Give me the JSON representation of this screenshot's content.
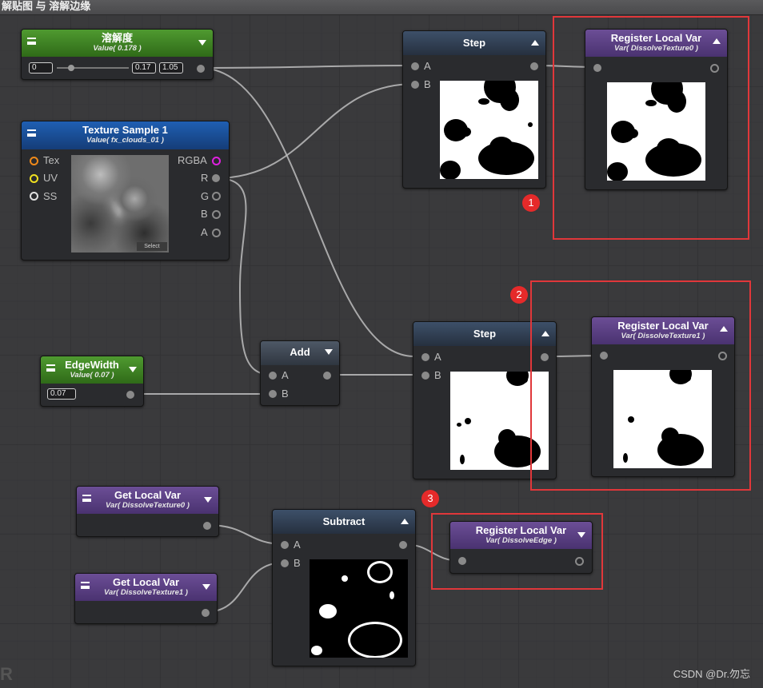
{
  "window": {
    "title": "解贴图 与 溶解边缘"
  },
  "nodes": {
    "dissolve": {
      "title": "溶解度",
      "subtitle": "Value( 0.178 )",
      "min": "0",
      "value": "0.17",
      "max": "1.05",
      "color": "#3f8a24"
    },
    "texture": {
      "title": "Texture Sample 1",
      "subtitle": "Value( fx_clouds_01 )",
      "inputs": [
        "Tex",
        "UV",
        "SS"
      ],
      "outputs": [
        "RGBA",
        "R",
        "G",
        "B",
        "A"
      ],
      "select": "Select",
      "color": "#1f5fb3"
    },
    "edge": {
      "title": "EdgeWidth",
      "subtitle": "Value( 0.07 )",
      "value": "0.07",
      "color": "#3f8a24"
    },
    "add": {
      "title": "Add",
      "inputs": [
        "A",
        "B"
      ]
    },
    "step1": {
      "title": "Step",
      "inputs": [
        "A",
        "B"
      ]
    },
    "step2": {
      "title": "Step",
      "inputs": [
        "A",
        "B"
      ]
    },
    "reg1": {
      "title": "Register Local Var",
      "subtitle": "Var( DissolveTexture0 )",
      "color": "#6c4e96"
    },
    "reg2": {
      "title": "Register Local Var",
      "subtitle": "Var( DissolveTexture1 )",
      "color": "#6c4e96"
    },
    "reg3": {
      "title": "Register Local Var",
      "subtitle": "Var( DissolveEdge )",
      "color": "#6c4e96"
    },
    "get1": {
      "title": "Get Local Var",
      "subtitle": "Var( DissolveTexture0 )"
    },
    "get2": {
      "title": "Get Local Var",
      "subtitle": "Var( DissolveTexture1 )"
    },
    "subtract": {
      "title": "Subtract",
      "inputs": [
        "A",
        "B"
      ]
    }
  },
  "annotations": {
    "badges": [
      "1",
      "2",
      "3"
    ],
    "highlight_color": "#e0373a"
  },
  "watermark": "CSDN @Dr.勿忘",
  "corner_mark": "R"
}
